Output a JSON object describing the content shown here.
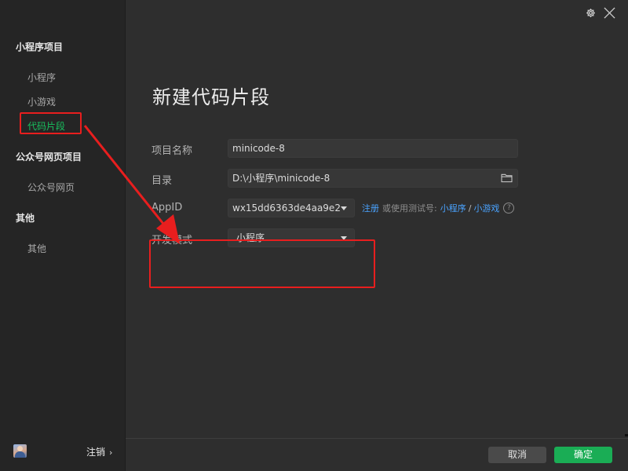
{
  "sidebar": {
    "groups": [
      {
        "title": "小程序项目",
        "items": [
          "小程序",
          "小游戏",
          "代码片段"
        ]
      },
      {
        "title": "公众号网页项目",
        "items": [
          "公众号网页"
        ]
      },
      {
        "title": "其他",
        "items": [
          "其他"
        ]
      }
    ],
    "active_item": "代码片段",
    "logout_label": "注销",
    "logout_chevron": "›"
  },
  "main": {
    "title": "新建代码片段",
    "form": {
      "project_name": {
        "label": "项目名称",
        "value": "minicode-8"
      },
      "directory": {
        "label": "目录",
        "value": "D:\\小程序\\minicode-8"
      },
      "appid": {
        "label": "AppID",
        "value": "wx15dd6363de4aa9e2",
        "register_link": "注册",
        "or_text": "或使用测试号:",
        "miniprogram_link": "小程序",
        "separator": "/",
        "minigame_link": "小游戏",
        "help": "?"
      },
      "dev_mode": {
        "label": "开发模式",
        "value": "小程序"
      }
    }
  },
  "footer": {
    "cancel_label": "取消",
    "confirm_label": "确定"
  },
  "icons": {
    "settings": "gear-icon",
    "close": "close-icon",
    "folder": "folder-icon",
    "dropdown": "chevron-down-icon"
  },
  "colors": {
    "accent_green": "#1aad55",
    "active_text": "#18c15f",
    "link_blue": "#4aa3ff",
    "annotation_red": "#e81e1e"
  }
}
